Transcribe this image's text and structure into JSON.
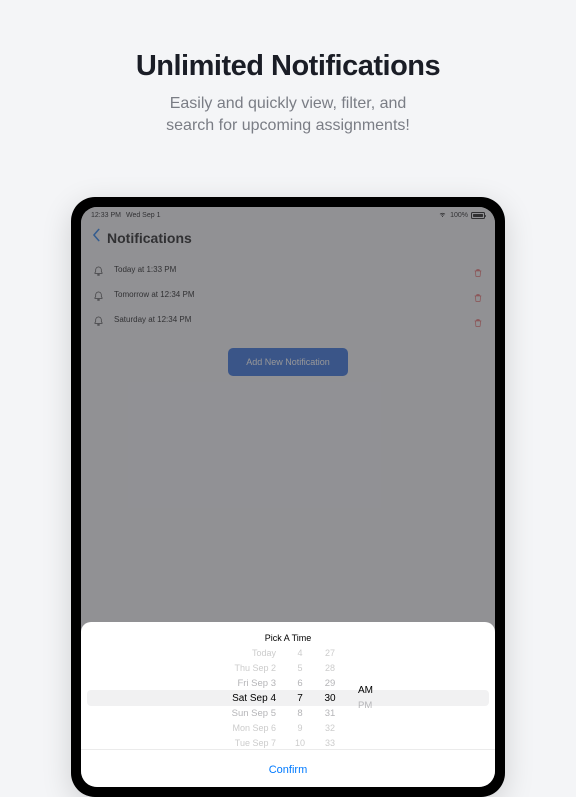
{
  "hero": {
    "title": "Unlimited Notifications",
    "subtitle_line1": "Easily and quickly view, filter, and",
    "subtitle_line2": "search for upcoming assignments!"
  },
  "status": {
    "time": "12:33 PM",
    "date": "Wed Sep 1",
    "battery_pct": "100%"
  },
  "nav": {
    "title": "Notifications"
  },
  "notifications": [
    {
      "label": "Today at 1:33 PM"
    },
    {
      "label": "Tomorrow at 12:34 PM"
    },
    {
      "label": "Saturday at 12:34 PM"
    }
  ],
  "buttons": {
    "add_new": "Add New Notification",
    "confirm": "Confirm"
  },
  "picker": {
    "title": "Pick A Time",
    "dates": [
      "Today",
      "Thu Sep 2",
      "Fri Sep 3",
      "Sat Sep 4",
      "Sun Sep 5",
      "Mon Sep 6",
      "Tue Sep 7"
    ],
    "hours": [
      "4",
      "5",
      "6",
      "7",
      "8",
      "9",
      "10"
    ],
    "minutes": [
      "27",
      "28",
      "29",
      "30",
      "31",
      "32",
      "33"
    ],
    "ampm": [
      "AM",
      "PM"
    ]
  }
}
